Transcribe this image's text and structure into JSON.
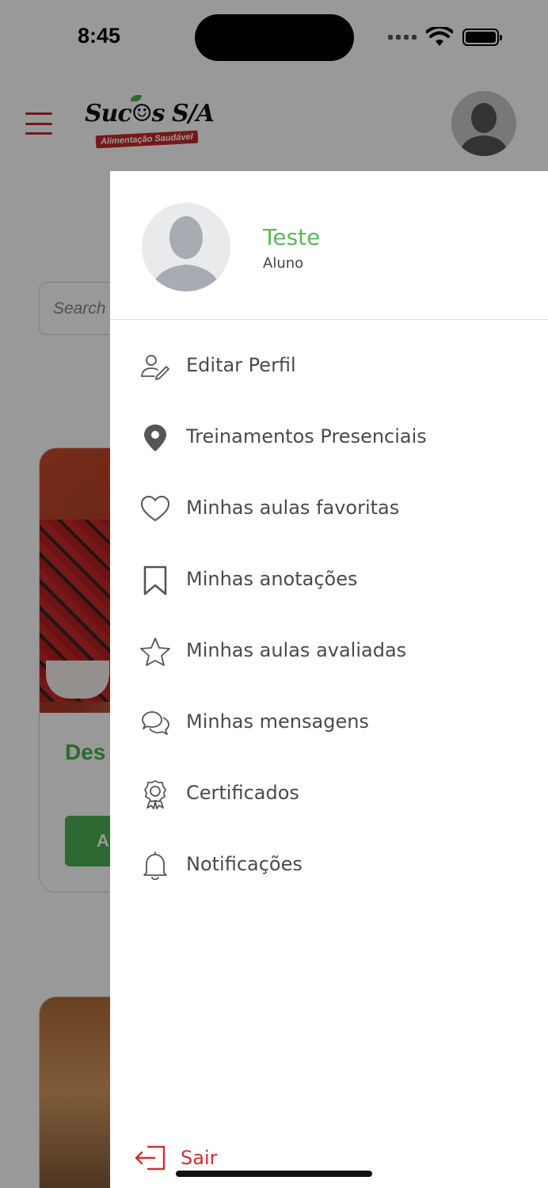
{
  "status_bar": {
    "time": "8:45"
  },
  "header": {
    "logo_main": "Suc☺s S/A",
    "logo_sub": "Alimentação Saudável"
  },
  "search": {
    "placeholder": "Search"
  },
  "cards": [
    {
      "title": "Des",
      "button_label": "A"
    },
    {
      "title": "",
      "button_label": ""
    }
  ],
  "drawer": {
    "profile": {
      "name": "Teste",
      "role": "Aluno"
    },
    "menu": [
      {
        "label": "Editar Perfil",
        "icon": "user-edit-icon"
      },
      {
        "label": "Treinamentos Presenciais",
        "icon": "map-pin-icon"
      },
      {
        "label": "Minhas aulas favoritas",
        "icon": "heart-icon"
      },
      {
        "label": "Minhas anotações",
        "icon": "bookmark-icon"
      },
      {
        "label": "Minhas aulas avaliadas",
        "icon": "star-icon"
      },
      {
        "label": "Minhas mensagens",
        "icon": "chat-bubbles-icon"
      },
      {
        "label": "Certificados",
        "icon": "award-icon"
      },
      {
        "label": "Notificações",
        "icon": "bell-icon"
      }
    ],
    "logout": {
      "label": "Sair",
      "icon": "logout-icon"
    }
  },
  "colors": {
    "brand_green": "#5cb85c",
    "brand_red": "#d32f2f",
    "menu_text": "#4a4a4a",
    "overlay": "rgba(0,0,0,0.40)"
  }
}
